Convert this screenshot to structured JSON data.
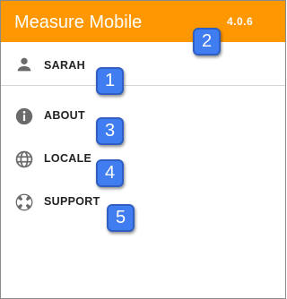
{
  "header": {
    "title": "Measure Mobile",
    "version": "4.0.6",
    "background_color": "#ff9800"
  },
  "menu": {
    "items": [
      {
        "label": "SARAH",
        "icon": "person-icon"
      },
      {
        "label": "ABOUT",
        "icon": "info-icon"
      },
      {
        "label": "LOCALE",
        "icon": "globe-icon"
      },
      {
        "label": "SUPPORT",
        "icon": "lifebuoy-icon"
      }
    ]
  },
  "annotations": [
    "1",
    "2",
    "3",
    "4",
    "5"
  ]
}
